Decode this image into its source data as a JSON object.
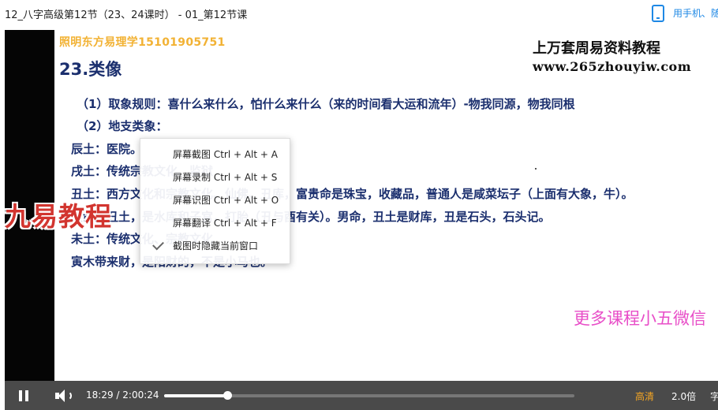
{
  "window": {
    "title": "12_八字高级第12节（23、24课时） - 01_第12节课",
    "phone_link": "用手机、随"
  },
  "slide": {
    "phone_line": "照明东方易理学15101905751",
    "heading": "23.类像",
    "site_title": "上万套周易资料教程",
    "site_url": "www.265zhouyiw.com",
    "rule_line": "（1）取象规则：喜什么来什么，怕什么来什么（来的时间看大运和流年）-物我同源，物我同根",
    "branch_line": "（2）地支类象：",
    "lines": [
      "辰土：医院。",
      "戌土：传统宗教文化、监狱",
      "丑土：西方文化和宗教文化、仙佛、丑库，富贵命是珠宝，收藏品，普通人是咸菜坛子（上面有大象，牛）。",
      "女命的丑土，是水库和子宫，打胎（丑与酉有关）。男命，丑土是财库，丑是石头，石头记。",
      "未土：传统文化、宗教文化",
      "寅木带来财，是阳财的，不是小马也。"
    ],
    "promo": "更多课程小五微信"
  },
  "watermark": "九易教程",
  "context_menu": {
    "items": [
      "屏幕截图 Ctrl + Alt + A",
      "屏幕录制 Ctrl + Alt + S",
      "屏幕识图 Ctrl + Alt + O",
      "屏幕翻译 Ctrl + Alt + F",
      "截图时隐藏当前窗口"
    ],
    "checked_item": 4
  },
  "controls": {
    "current_time": "18:29",
    "separator": "/",
    "total_time": "2:00:24",
    "progress": 0.154,
    "quality": "高清",
    "speed": "2.0倍",
    "subtitle": "字",
    "accent": "#f5a623"
  }
}
